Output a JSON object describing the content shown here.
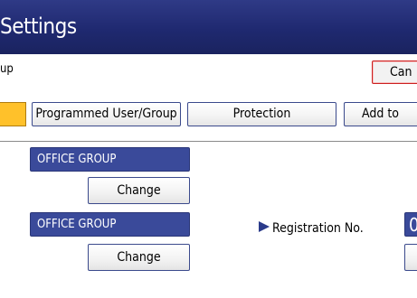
{
  "header": {
    "title": "Settings"
  },
  "subheader": {
    "label": "up",
    "cancel_label": "Can"
  },
  "tabs": {
    "programmed": "Programmed User/Group",
    "protection": "Protection",
    "add_to": "Add to"
  },
  "entries": [
    {
      "group_name": "OFFICE GROUP",
      "change_label": "Change"
    },
    {
      "group_name": "OFFICE GROUP",
      "change_label": "Change"
    }
  ],
  "registration": {
    "label": "Registration No.",
    "value_partial": "0"
  },
  "colors": {
    "title_bar": "#1f2970",
    "selected_tab": "#ffc12a",
    "field_fill": "#3a4a9a",
    "cancel_border": "#cc2020"
  },
  "icons": {
    "registration_arrow": "right-triangle-arrow-icon"
  }
}
